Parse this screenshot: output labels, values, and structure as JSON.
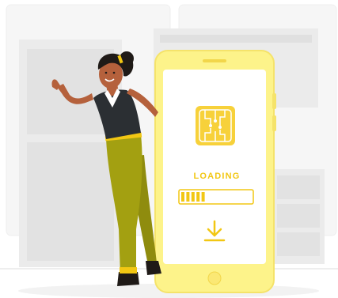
{
  "illustration": {
    "loading_text": "LOADING",
    "progress_fraction": 0.35,
    "progress_segments_total": 14,
    "icons": {
      "chip": "microchip-icon",
      "download": "download-arrow-icon"
    }
  },
  "colors": {
    "accent_yellow": "#f2c713",
    "phone_body": "#fdf38a",
    "phone_screen": "#ffffff",
    "chip_fill": "#f7d13a",
    "skin": "#b5613c",
    "shirt": "#2b2f33",
    "pants": "#a3a011",
    "hair": "#1f1a17",
    "background_shapes": "#ececec"
  }
}
